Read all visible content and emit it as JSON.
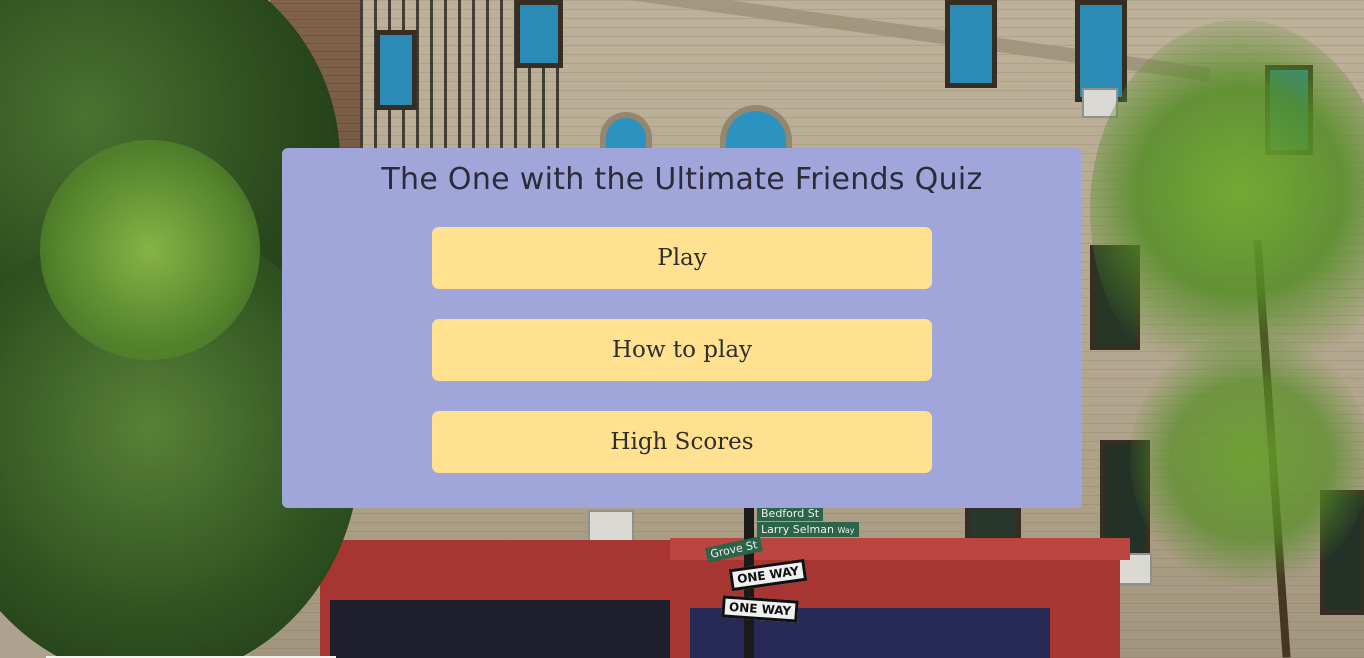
{
  "page": {
    "title": "The One with the Ultimate Friends Quiz"
  },
  "menu": {
    "play_label": "Play",
    "how_to_play_label": "How to play",
    "high_scores_label": "High Scores"
  },
  "background": {
    "street_signs": {
      "bedford": "Bedford St",
      "larry_selman": "Larry Selman",
      "larry_selman_sub": "Way",
      "grove": "Grove St",
      "one_way_top": "ONE WAY",
      "one_way_bottom": "ONE WAY"
    }
  },
  "colors": {
    "card_background": "#a1a6da",
    "button_background": "#ffe190",
    "title_text": "#2b2b3a",
    "button_text": "#2e2e2e"
  }
}
